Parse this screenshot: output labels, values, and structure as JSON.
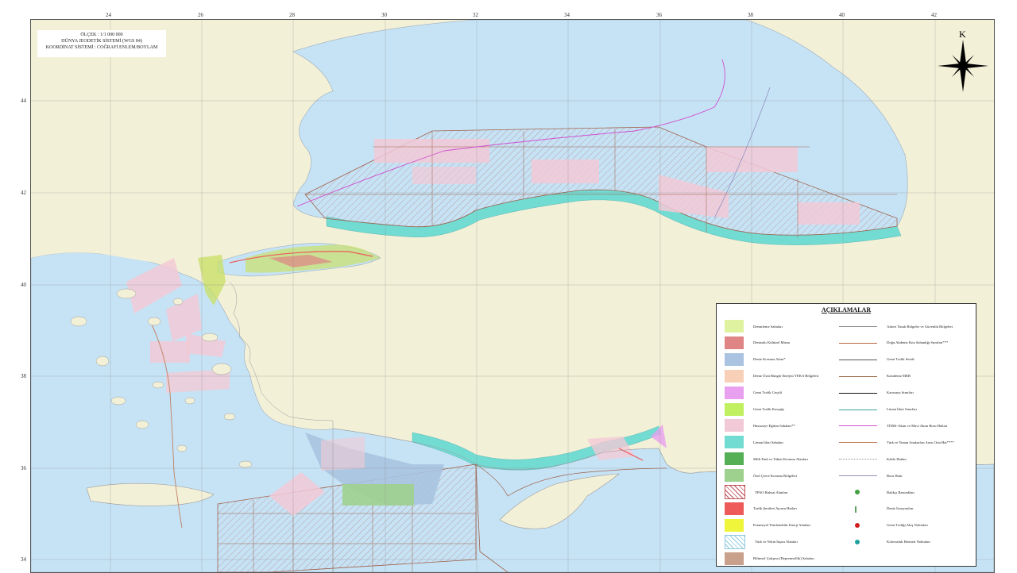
{
  "scale_box": {
    "line1": "ÖLÇEK : 1/1 000 000",
    "line2": "DÜNYA JEODETİK SİSTEMİ (WGS 84)",
    "line3": "KOORDİNAT SİSTEMİ : COĞRAFİ ENLEM/BOYLAM"
  },
  "north_label": "K",
  "grid": {
    "longitude_ticks": [
      "24",
      "26",
      "28",
      "30",
      "32",
      "34",
      "36",
      "38",
      "40",
      "42"
    ],
    "latitude_ticks": [
      "44",
      "42",
      "40",
      "38",
      "36",
      "34"
    ]
  },
  "colors": {
    "sea": "#c6e3f5",
    "land": "#f3f0d8",
    "territorial_band": "#72dcd3",
    "fishing_area": "#f2c9d6"
  },
  "legend": {
    "title": "AÇIKLAMALAR",
    "area_items": [
      {
        "label": "Demirleme Sahaları",
        "color": "#dff2a0",
        "pattern": "solid"
      },
      {
        "label": "Denizaltı Kültürel Mirası",
        "color": "#e08585",
        "pattern": "solid"
      },
      {
        "label": "Deniz Koruma Alanı*",
        "color": "#a9c3e0",
        "pattern": "solid"
      },
      {
        "label": "Deniz Üstü Rüzgâr Enerjisi YEKA Bölgeleri",
        "color": "#f8d0b8",
        "pattern": "solid"
      },
      {
        "label": "Gemi Trafik Geçidi",
        "color": "#e9a0f0",
        "pattern": "solid"
      },
      {
        "label": "Gemi Trafik Kavşağı",
        "color": "#c0f060",
        "pattern": "solid"
      },
      {
        "label": "Hassasiye Eğitim Sahaları**",
        "color": "#f2c9d6",
        "pattern": "solid"
      },
      {
        "label": "Liman İdari Sahaları",
        "color": "#72dcd3",
        "pattern": "solid"
      },
      {
        "label": "Milli Park ve Tabiat Koruma Alanları",
        "color": "#55b055",
        "pattern": "solid"
      },
      {
        "label": "Özel Çevre Koruma Bölgeleri",
        "color": "#9ed08e",
        "pattern": "solid"
      },
      {
        "label": "TPAO Ruhsat Alanları",
        "color": "#c0505a",
        "pattern": "hatch"
      },
      {
        "label": "Trafik Şeritleri Ayırım Hatları",
        "color": "#ee5a5a",
        "pattern": "solid"
      },
      {
        "label": "Potansiyel Yenilenebilir Enerji Alanları",
        "color": "#eef53a",
        "pattern": "solid"
      },
      {
        "label": "Türk ve Yekin İnşası Alanları",
        "color": "#8fc8dd",
        "pattern": "hatch"
      },
      {
        "label": "Bilimsel Çalışma (Depremsellik) Sahaları",
        "color": "#c8a08c",
        "pattern": "solid"
      }
    ],
    "line_items": [
      {
        "label": "Askeri Yasak Bölgeler ve Güvenlik Bölgeleri",
        "color": "#8c8c8c",
        "style": "thin"
      },
      {
        "label": "Doğu Akdeniz Kıta Sahanlığı Sınırları***",
        "color": "#b86a40",
        "style": "solid"
      },
      {
        "label": "Gemi Trafik Seridi",
        "color": "#555555",
        "style": "solid"
      },
      {
        "label": "Karadeniz MEB",
        "color": "#a07050",
        "style": "solid"
      },
      {
        "label": "Karasuyu Sınırları",
        "color": "#111111",
        "style": "bold"
      },
      {
        "label": "Liman İdari Sınırları",
        "color": "#3aa0a0",
        "style": "solid"
      },
      {
        "label": "TÜRK-Akım ve Mavi Akım Boru Hatları",
        "color": "#d050d0",
        "style": "solid"
      },
      {
        "label": "Türk ve Yunan Anakarları Arası Orta Hat****",
        "color": "#c08060",
        "style": "solid"
      },
      {
        "label": "Kablo Hatları",
        "color": "#909090",
        "style": "dotted"
      },
      {
        "label": "Boru Hattı",
        "color": "#9090c0",
        "style": "solid"
      },
      {
        "label": "Balıkçı Barınakları",
        "color": "#40a040",
        "style": "symbol-boat"
      },
      {
        "label": "Deniz İstasyonları",
        "color": "#60a060",
        "style": "symbol-dagger"
      },
      {
        "label": "Gemi Trafiği Akış Noktaları",
        "color": "#d02020",
        "style": "symbol-dot"
      },
      {
        "label": "Kılavuzluk Hizmeti Noktaları",
        "color": "#20a0a0",
        "style": "symbol-star"
      }
    ]
  }
}
